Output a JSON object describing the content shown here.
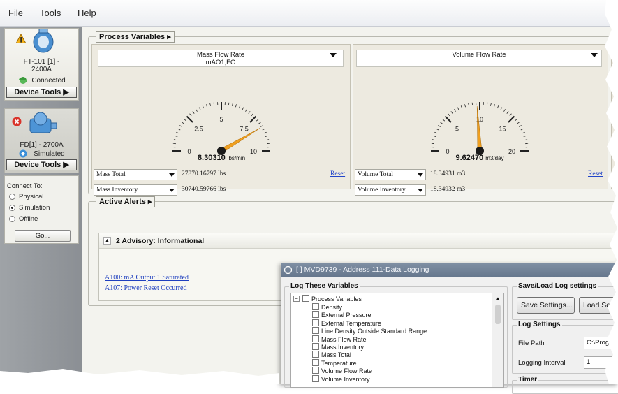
{
  "menu": {
    "items": [
      "File",
      "Tools",
      "Help"
    ]
  },
  "devices": [
    {
      "name": "FT-101  [1] -\n2400A",
      "status": "Connected",
      "tools_label": "Device Tools ▶",
      "alert_icon": "warning-icon",
      "status_icon": "connected-icon"
    },
    {
      "name": "FD[1] - 2700A",
      "status": "Simulated",
      "tools_label": "Device Tools ▶",
      "alert_icon": "error-icon",
      "status_icon": "simulated-icon"
    }
  ],
  "connect": {
    "title": "Connect To:",
    "options": [
      "Physical",
      "Simulation",
      "Offline"
    ],
    "selected": "Simulation",
    "go_label": "Go..."
  },
  "process_variables": {
    "title": "Process Variables ▸",
    "gauges": [
      {
        "label": "Mass Flow Rate\nmAO1,FO",
        "value": "8.30310",
        "unit": "lbs/min",
        "value_num": 8.3031,
        "ticks": [
          "0",
          "2.5",
          "5",
          "7.5",
          "10"
        ],
        "max": 10,
        "total_label": "Mass Total",
        "total_value": "27870.16797 lbs",
        "inv_label": "Mass Inventory",
        "inv_value": "30740.59766 lbs",
        "reset": "Reset"
      },
      {
        "label": "Volume Flow Rate",
        "value": "9.62470",
        "unit": "m3/day",
        "value_num": 9.6247,
        "ticks": [
          "0",
          "5",
          "10",
          "15",
          "20"
        ],
        "max": 20,
        "total_label": "Volume Total",
        "total_value": "18.34931 m3",
        "inv_label": "Volume Inventory",
        "inv_value": "18.34932 m3",
        "reset": "Reset"
      }
    ]
  },
  "alerts": {
    "title": "Active Alerts ▸",
    "header": "2 Advisory: Informational",
    "items": [
      "A100: mA Output 1 Saturated",
      "A107: Power Reset Occurred"
    ]
  },
  "dialog": {
    "title": "[    ] MVD9739 - Address 111-Data Logging",
    "log_title": "Log These Variables",
    "tree_root": "Process Variables",
    "variables": [
      "Density",
      "External Pressure",
      "External Temperature",
      "Line Density Outside Standard Range",
      "Mass Flow Rate",
      "Mass Inventory",
      "Mass Total",
      "Temperature",
      "Volume Flow Rate",
      "Volume Inventory"
    ],
    "saveload_title": "Save/Load Log settings",
    "save_label": "Save Settings...",
    "load_label": "Load Setti",
    "logsettings_title": "Log Settings",
    "filepath_label": "File Path :",
    "filepath_value": "C:\\Prograr",
    "interval_label": "Logging Interval",
    "interval_value": "1",
    "timer_title": "Timer"
  },
  "colors": {
    "needle": "#f0a020",
    "link": "#1e3fbf",
    "panel": "#edeae0",
    "sidebar": "#9a9ea3",
    "dialog_title": "#6f7f94"
  }
}
